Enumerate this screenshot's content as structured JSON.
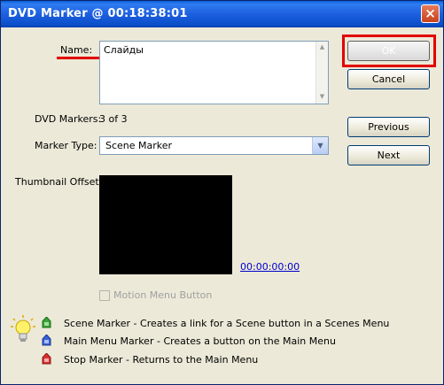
{
  "window": {
    "title": "DVD Marker @ 00:18:38:01",
    "close_glyph": "×"
  },
  "form": {
    "name_label": "Name:",
    "name_value": "Слайды",
    "markers_label": "DVD Markers:",
    "markers_value": "3 of 3",
    "type_label": "Marker Type:",
    "type_value": "Scene Marker",
    "thumb_label": "Thumbnail Offset:",
    "timecode": "00:00:00:00",
    "motion_menu_label": "Motion Menu Button"
  },
  "buttons": {
    "ok": "OK",
    "cancel": "Cancel",
    "previous": "Previous",
    "next": "Next"
  },
  "legend": {
    "scene": "Scene Marker - Creates a link for a Scene button in a Scenes Menu",
    "main": "Main Menu Marker - Creates a button on the Main Menu",
    "stop": "Stop Marker - Returns to the Main Menu"
  },
  "icons": {
    "scene": "green-marker-icon",
    "main": "blue-marker-icon",
    "stop": "red-marker-icon",
    "bulb": "lightbulb-icon"
  },
  "colors": {
    "highlight": "#e20000",
    "scene_marker": "#3aa335",
    "main_marker": "#3a5fd8",
    "stop_marker": "#d93030"
  }
}
